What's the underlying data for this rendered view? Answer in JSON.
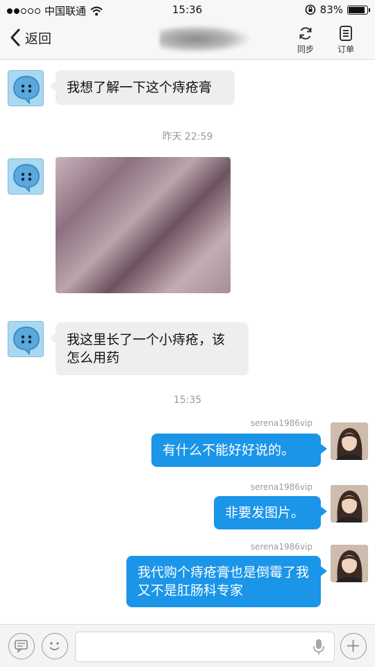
{
  "status_bar": {
    "carrier": "中国联通",
    "time": "15:36",
    "battery_percent": "83%",
    "battery_level": 0.83
  },
  "nav_bar": {
    "back_label": "返回",
    "sync_label": "同步",
    "order_label": "订单"
  },
  "messages": {
    "m1": "我想了解一下这个痔疮膏",
    "ts1": "昨天 22:59",
    "m3": "我这里长了一个小痔疮，该怎么用药",
    "ts2": "15:35",
    "r1_sender": "serena1986vip",
    "r1": "有什么不能好好说的。",
    "r2_sender": "serena1986vip",
    "r2": "非要发图片。",
    "r3_sender": "serena1986vip",
    "r3": "我代购个痔疮膏也是倒霉了我又不是肛肠科专家"
  },
  "colors": {
    "accent": "#1a95e8",
    "incoming_bubble": "#eeeeee"
  }
}
